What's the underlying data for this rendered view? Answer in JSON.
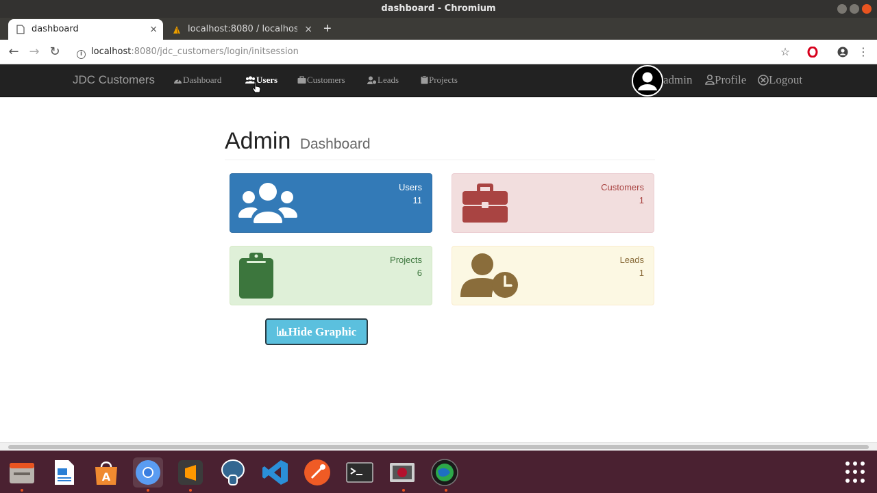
{
  "window": {
    "title": "dashboard - Chromium"
  },
  "tabs": [
    {
      "label": "dashboard",
      "active": true
    },
    {
      "label": "localhost:8080 / localhost",
      "active": false
    }
  ],
  "address_bar": {
    "host": "localhost",
    "rest": ":8080/jdc_customers/login/initsession"
  },
  "navbar": {
    "brand": "JDC Customers",
    "links": [
      {
        "label": "Dashboard",
        "icon": "dashboard-icon"
      },
      {
        "label": "Users",
        "icon": "users-icon"
      },
      {
        "label": "Customers",
        "icon": "briefcase-icon"
      },
      {
        "label": "Leads",
        "icon": "user-clock-icon"
      },
      {
        "label": "Projects",
        "icon": "folder-icon"
      }
    ],
    "user": "admin",
    "profile": "Profile",
    "logout": "Logout"
  },
  "header": {
    "title": "Admin",
    "subtitle": "Dashboard"
  },
  "panels": [
    {
      "label": "Users",
      "count": "11",
      "color": "#337ab7",
      "icon": "users-icon"
    },
    {
      "label": "Customers",
      "count": "1",
      "color": "#f2dede",
      "icon": "briefcase-icon"
    },
    {
      "label": "Projects",
      "count": "6",
      "color": "#dff0d8",
      "icon": "clipboard-icon"
    },
    {
      "label": "Leads",
      "count": "1",
      "color": "#fcf8e3",
      "icon": "user-clock-icon"
    }
  ],
  "hide_graphic_button": "Hide Graphic",
  "dock": {
    "apps": [
      "files",
      "libreoffice-writer",
      "software-center",
      "chromium",
      "sublime-text",
      "pgadmin",
      "vscode",
      "postman",
      "terminal",
      "virtualbox",
      "system-monitor"
    ]
  }
}
